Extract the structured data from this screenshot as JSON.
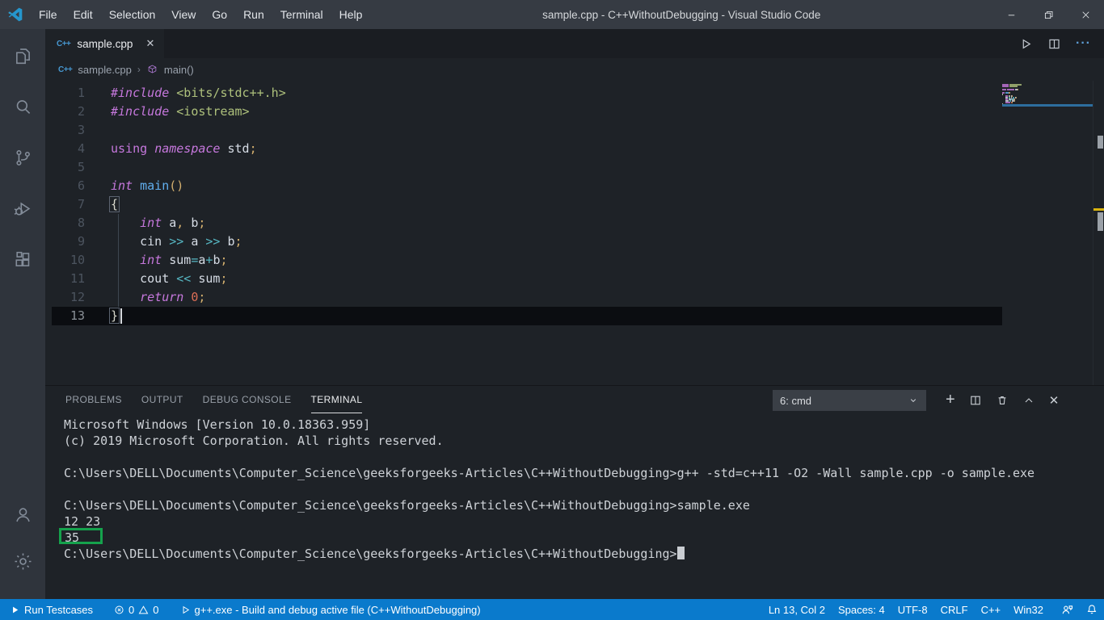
{
  "colors": {
    "statusbar": "#0a7acc",
    "kw": "#c678dd",
    "fn": "#61afef",
    "str": "#aec17c",
    "num": "#dd6e56",
    "punct": "#d3af6e",
    "op": "#56b6c2",
    "pl": "#d6dce5",
    "brace": "#d8d8cc",
    "greenbox": "#15a24c",
    "minimapline": "#2d6e9e"
  },
  "title_bar": {
    "menus": [
      "File",
      "Edit",
      "Selection",
      "View",
      "Go",
      "Run",
      "Terminal",
      "Help"
    ],
    "title": "sample.cpp - C++WithoutDebugging - Visual Studio Code",
    "window_controls": [
      "minimize",
      "restore",
      "close"
    ]
  },
  "activity_bar": {
    "items": [
      "explorer",
      "search",
      "source-control",
      "run-and-debug",
      "extensions"
    ],
    "bottom": [
      "account",
      "manage"
    ]
  },
  "tab": {
    "label": "sample.cpp"
  },
  "editor_actions": [
    "run",
    "split-editor",
    "more-actions"
  ],
  "breadcrumb": {
    "file": "sample.cpp",
    "separator": "›",
    "symbol": "main()"
  },
  "editor": {
    "current_line": 13,
    "lines": [
      {
        "tokens": [
          [
            "#include",
            "kw"
          ],
          [
            " ",
            "pl"
          ],
          [
            "<bits/stdc++.h>",
            "str"
          ]
        ]
      },
      {
        "tokens": [
          [
            "#include",
            "kw"
          ],
          [
            " ",
            "pl"
          ],
          [
            "<iostream>",
            "str"
          ]
        ]
      },
      {
        "tokens": []
      },
      {
        "tokens": [
          [
            "using",
            "kw2"
          ],
          [
            " ",
            "pl"
          ],
          [
            "namespace",
            "kw"
          ],
          [
            " ",
            "pl"
          ],
          [
            "std",
            "pl"
          ],
          [
            ";",
            "punct"
          ]
        ]
      },
      {
        "tokens": []
      },
      {
        "tokens": [
          [
            "int",
            "kw"
          ],
          [
            " ",
            "pl"
          ],
          [
            "main",
            "fn"
          ],
          [
            "()",
            "punct"
          ]
        ]
      },
      {
        "tokens": [
          [
            "{",
            "brm"
          ]
        ]
      },
      {
        "tokens": [
          [
            "    ",
            "pl"
          ],
          [
            "int",
            "kw"
          ],
          [
            " ",
            "pl"
          ],
          [
            "a",
            "pl"
          ],
          [
            ",",
            "punct"
          ],
          [
            " ",
            "pl"
          ],
          [
            "b",
            "pl"
          ],
          [
            ";",
            "punct"
          ]
        ]
      },
      {
        "tokens": [
          [
            "    ",
            "pl"
          ],
          [
            "cin",
            "pl"
          ],
          [
            " ",
            "pl"
          ],
          [
            ">>",
            "op"
          ],
          [
            " ",
            "pl"
          ],
          [
            "a",
            "pl"
          ],
          [
            " ",
            "pl"
          ],
          [
            ">>",
            "op"
          ],
          [
            " ",
            "pl"
          ],
          [
            "b",
            "pl"
          ],
          [
            ";",
            "punct"
          ]
        ]
      },
      {
        "tokens": [
          [
            "    ",
            "pl"
          ],
          [
            "int",
            "kw"
          ],
          [
            " ",
            "pl"
          ],
          [
            "sum",
            "pl"
          ],
          [
            "=",
            "op"
          ],
          [
            "a",
            "pl"
          ],
          [
            "+",
            "op"
          ],
          [
            "b",
            "pl"
          ],
          [
            ";",
            "punct"
          ]
        ]
      },
      {
        "tokens": [
          [
            "    ",
            "pl"
          ],
          [
            "cout",
            "pl"
          ],
          [
            " ",
            "pl"
          ],
          [
            "<<",
            "op"
          ],
          [
            " ",
            "pl"
          ],
          [
            "sum",
            "pl"
          ],
          [
            ";",
            "punct"
          ]
        ]
      },
      {
        "tokens": [
          [
            "    ",
            "pl"
          ],
          [
            "return",
            "kw"
          ],
          [
            " ",
            "pl"
          ],
          [
            "0",
            "num"
          ],
          [
            ";",
            "punct"
          ]
        ]
      },
      {
        "tokens": [
          [
            "}",
            "brm"
          ]
        ]
      }
    ]
  },
  "panel": {
    "tabs": [
      "PROBLEMS",
      "OUTPUT",
      "DEBUG CONSOLE",
      "TERMINAL"
    ],
    "active_tab": "TERMINAL",
    "terminal_select": "6: cmd",
    "actions": [
      "new-terminal",
      "split-terminal",
      "kill-terminal",
      "maximize-panel",
      "close-panel"
    ],
    "terminal_lines": [
      {
        "text": "Microsoft Windows [Version 10.0.18363.959]"
      },
      {
        "text": "(c) 2019 Microsoft Corporation. All rights reserved."
      },
      {
        "text": ""
      },
      {
        "text": "C:\\Users\\DELL\\Documents\\Computer_Science\\geeksforgeeks-Articles\\C++WithoutDebugging>g++ -std=c++11 -O2 -Wall sample.cpp -o sample.exe"
      },
      {
        "text": ""
      },
      {
        "text": "C:\\Users\\DELL\\Documents\\Computer_Science\\geeksforgeeks-Articles\\C++WithoutDebugging>sample.exe"
      },
      {
        "text": "12 23"
      },
      {
        "text": "35",
        "highlighted": true
      },
      {
        "text": "C:\\Users\\DELL\\Documents\\Computer_Science\\geeksforgeeks-Articles\\C++WithoutDebugging>",
        "cursor": true
      }
    ]
  },
  "status_bar": {
    "run_label": "Run Testcases",
    "errors": "0",
    "warnings": "0",
    "debug_label": "g++.exe - Build and debug active file (C++WithoutDebugging)",
    "right": [
      "Ln 13, Col 2",
      "Spaces: 4",
      "UTF-8",
      "CRLF",
      "C++",
      "Win32"
    ]
  }
}
